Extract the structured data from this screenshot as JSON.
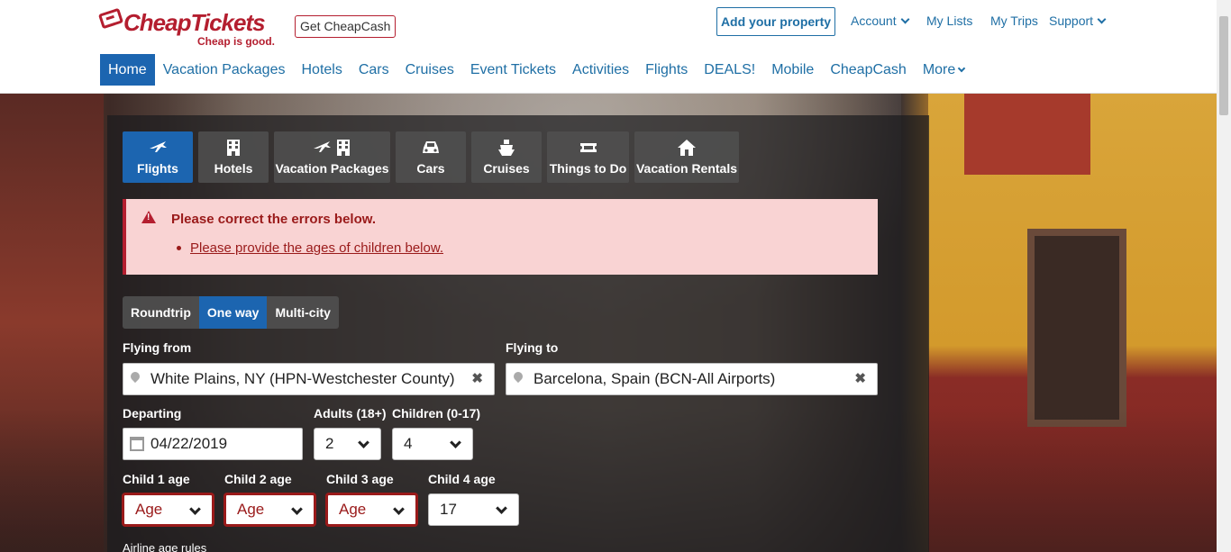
{
  "header": {
    "logo_brand": "CheapTickets",
    "logo_slogan": "Cheap is good.",
    "get_cheapcash": "Get CheapCash",
    "add_property": "Add your property",
    "account": "Account",
    "my_lists": "My Lists",
    "my_trips": "My Trips",
    "support": "Support"
  },
  "nav": {
    "items": [
      "Home",
      "Vacation Packages",
      "Hotels",
      "Cars",
      "Cruises",
      "Event Tickets",
      "Activities",
      "Flights",
      "DEALS!",
      "Mobile",
      "CheapCash",
      "More"
    ],
    "active": "Home"
  },
  "search": {
    "tabs": [
      {
        "label": "Flights",
        "icon": "plane-icon"
      },
      {
        "label": "Hotels",
        "icon": "building-icon"
      },
      {
        "label": "Vacation Packages",
        "icon": "plane-building-icon"
      },
      {
        "label": "Cars",
        "icon": "car-icon"
      },
      {
        "label": "Cruises",
        "icon": "ship-icon"
      },
      {
        "label": "Things to Do",
        "icon": "ticket-icon"
      },
      {
        "label": "Vacation Rentals",
        "icon": "house-icon"
      }
    ],
    "active_tab": "Flights",
    "error": {
      "title": "Please correct the errors below.",
      "items": [
        "Please provide the ages of children below."
      ]
    },
    "trip_types": [
      "Roundtrip",
      "One way",
      "Multi-city"
    ],
    "active_trip_type": "One way",
    "flying_from": {
      "label": "Flying from",
      "value": "White Plains, NY (HPN-Westchester County)"
    },
    "flying_to": {
      "label": "Flying to",
      "value": "Barcelona, Spain (BCN-All Airports)"
    },
    "departing": {
      "label": "Departing",
      "value": "04/22/2019"
    },
    "adults": {
      "label": "Adults (18+)",
      "value": "2"
    },
    "children": {
      "label": "Children (0-17)",
      "value": "4"
    },
    "child_ages": [
      {
        "label": "Child 1 age",
        "value": "Age",
        "error": true
      },
      {
        "label": "Child 2 age",
        "value": "Age",
        "error": true
      },
      {
        "label": "Child 3 age",
        "value": "Age",
        "error": true
      },
      {
        "label": "Child 4 age",
        "value": "17",
        "error": false
      }
    ],
    "airline_rules": "Airline age rules"
  },
  "colors": {
    "brand_red": "#b41e2f",
    "link_blue": "#1f6fa5",
    "active_blue": "#1c65b0",
    "error_bg": "#f9d3d3"
  }
}
